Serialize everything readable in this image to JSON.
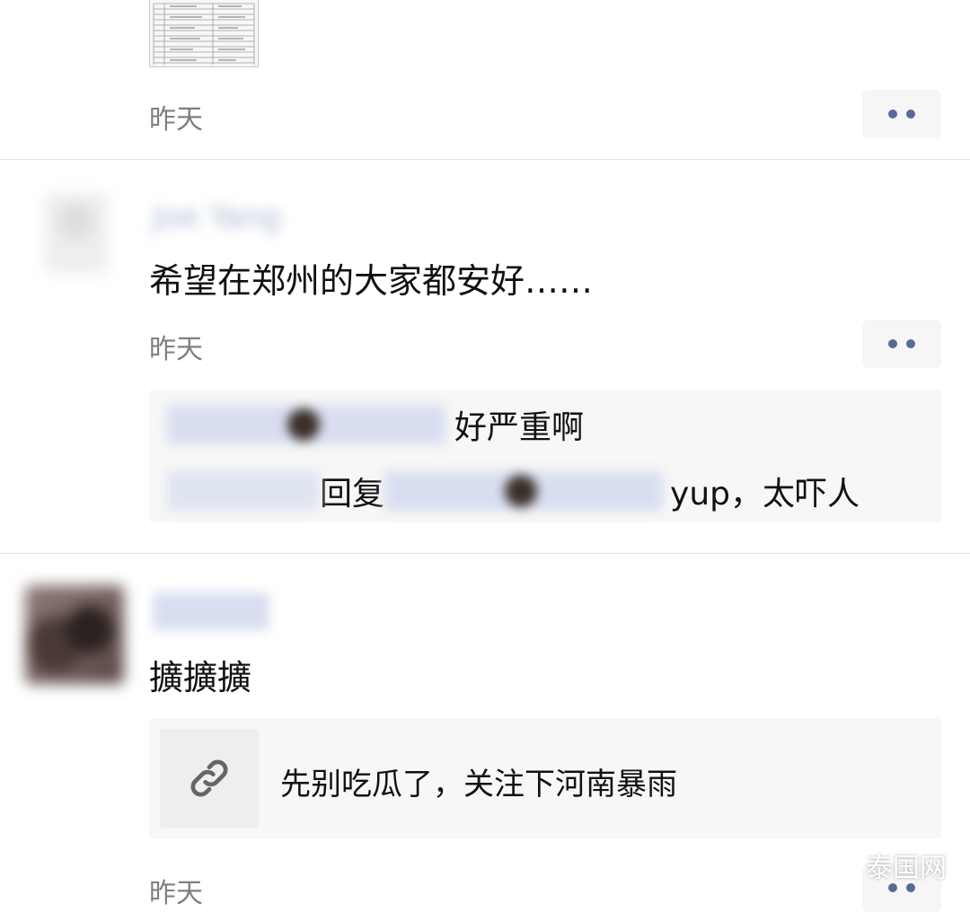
{
  "comments": [
    {
      "time": "昨天"
    },
    {
      "author": "Joe Yang",
      "text": "希望在郑州的大家都安好……",
      "time": "昨天",
      "replies": [
        {
          "text": "好严重啊"
        },
        {
          "from": "Joe Yang",
          "reply_word": "回复",
          "text": "yup，太吓人"
        }
      ]
    },
    {
      "text": "擴擴擴",
      "link": {
        "icon": "link-icon",
        "title": "先别吃瓜了，关注下河南暴雨"
      },
      "time": "昨天"
    }
  ],
  "watermark": {
    "icon": "wechat-icon",
    "label": "泰国网"
  },
  "colors": {
    "link_blue": "#576b95",
    "timestamp_gray": "#7f7f7f",
    "card_bg": "#f7f7f7"
  }
}
